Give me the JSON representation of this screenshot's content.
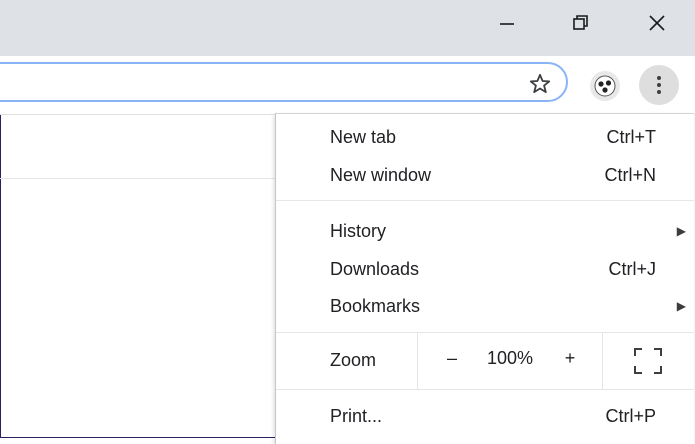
{
  "window_controls": {
    "minimize": "minimize-icon",
    "restore": "restore-icon",
    "close": "close-icon"
  },
  "toolbar": {
    "bookmark_star": "star-icon",
    "profile": "profile-avatar-icon",
    "menu": "more-vert-icon"
  },
  "menu": {
    "items": [
      {
        "label": "New tab",
        "shortcut": "Ctrl+T"
      },
      {
        "label": "New window",
        "shortcut": "Ctrl+N"
      },
      {
        "label": "History",
        "shortcut": ""
      },
      {
        "label": "Downloads",
        "shortcut": "Ctrl+J"
      },
      {
        "label": "Bookmarks",
        "shortcut": ""
      },
      {
        "label": "Print...",
        "shortcut": "Ctrl+P"
      }
    ],
    "zoom": {
      "label": "Zoom",
      "minus": "–",
      "value": "100%",
      "plus": "+"
    },
    "submenu_arrow": "▶"
  },
  "colors": {
    "titlebar": "#dee1e6",
    "omnibox_border": "#8ab4f8",
    "menu_bg": "#ffffff",
    "separator": "#e6e6e6"
  }
}
